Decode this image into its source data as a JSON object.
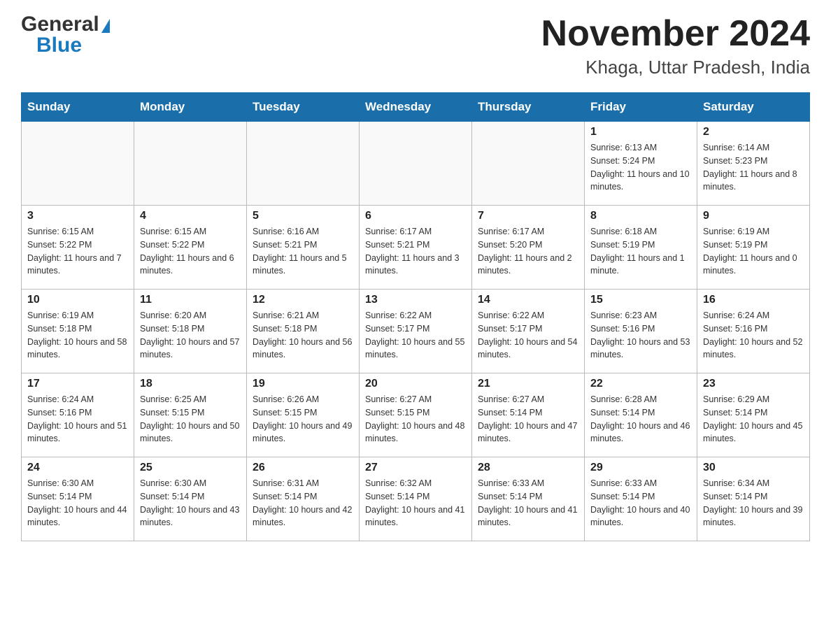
{
  "header": {
    "logo_general": "General",
    "logo_arrow": "▶",
    "logo_blue": "Blue",
    "month_title": "November 2024",
    "location": "Khaga, Uttar Pradesh, India"
  },
  "days_of_week": [
    "Sunday",
    "Monday",
    "Tuesday",
    "Wednesday",
    "Thursday",
    "Friday",
    "Saturday"
  ],
  "weeks": [
    {
      "cells": [
        {
          "day": "",
          "info": ""
        },
        {
          "day": "",
          "info": ""
        },
        {
          "day": "",
          "info": ""
        },
        {
          "day": "",
          "info": ""
        },
        {
          "day": "",
          "info": ""
        },
        {
          "day": "1",
          "info": "Sunrise: 6:13 AM\nSunset: 5:24 PM\nDaylight: 11 hours and 10 minutes."
        },
        {
          "day": "2",
          "info": "Sunrise: 6:14 AM\nSunset: 5:23 PM\nDaylight: 11 hours and 8 minutes."
        }
      ]
    },
    {
      "cells": [
        {
          "day": "3",
          "info": "Sunrise: 6:15 AM\nSunset: 5:22 PM\nDaylight: 11 hours and 7 minutes."
        },
        {
          "day": "4",
          "info": "Sunrise: 6:15 AM\nSunset: 5:22 PM\nDaylight: 11 hours and 6 minutes."
        },
        {
          "day": "5",
          "info": "Sunrise: 6:16 AM\nSunset: 5:21 PM\nDaylight: 11 hours and 5 minutes."
        },
        {
          "day": "6",
          "info": "Sunrise: 6:17 AM\nSunset: 5:21 PM\nDaylight: 11 hours and 3 minutes."
        },
        {
          "day": "7",
          "info": "Sunrise: 6:17 AM\nSunset: 5:20 PM\nDaylight: 11 hours and 2 minutes."
        },
        {
          "day": "8",
          "info": "Sunrise: 6:18 AM\nSunset: 5:19 PM\nDaylight: 11 hours and 1 minute."
        },
        {
          "day": "9",
          "info": "Sunrise: 6:19 AM\nSunset: 5:19 PM\nDaylight: 11 hours and 0 minutes."
        }
      ]
    },
    {
      "cells": [
        {
          "day": "10",
          "info": "Sunrise: 6:19 AM\nSunset: 5:18 PM\nDaylight: 10 hours and 58 minutes."
        },
        {
          "day": "11",
          "info": "Sunrise: 6:20 AM\nSunset: 5:18 PM\nDaylight: 10 hours and 57 minutes."
        },
        {
          "day": "12",
          "info": "Sunrise: 6:21 AM\nSunset: 5:18 PM\nDaylight: 10 hours and 56 minutes."
        },
        {
          "day": "13",
          "info": "Sunrise: 6:22 AM\nSunset: 5:17 PM\nDaylight: 10 hours and 55 minutes."
        },
        {
          "day": "14",
          "info": "Sunrise: 6:22 AM\nSunset: 5:17 PM\nDaylight: 10 hours and 54 minutes."
        },
        {
          "day": "15",
          "info": "Sunrise: 6:23 AM\nSunset: 5:16 PM\nDaylight: 10 hours and 53 minutes."
        },
        {
          "day": "16",
          "info": "Sunrise: 6:24 AM\nSunset: 5:16 PM\nDaylight: 10 hours and 52 minutes."
        }
      ]
    },
    {
      "cells": [
        {
          "day": "17",
          "info": "Sunrise: 6:24 AM\nSunset: 5:16 PM\nDaylight: 10 hours and 51 minutes."
        },
        {
          "day": "18",
          "info": "Sunrise: 6:25 AM\nSunset: 5:15 PM\nDaylight: 10 hours and 50 minutes."
        },
        {
          "day": "19",
          "info": "Sunrise: 6:26 AM\nSunset: 5:15 PM\nDaylight: 10 hours and 49 minutes."
        },
        {
          "day": "20",
          "info": "Sunrise: 6:27 AM\nSunset: 5:15 PM\nDaylight: 10 hours and 48 minutes."
        },
        {
          "day": "21",
          "info": "Sunrise: 6:27 AM\nSunset: 5:14 PM\nDaylight: 10 hours and 47 minutes."
        },
        {
          "day": "22",
          "info": "Sunrise: 6:28 AM\nSunset: 5:14 PM\nDaylight: 10 hours and 46 minutes."
        },
        {
          "day": "23",
          "info": "Sunrise: 6:29 AM\nSunset: 5:14 PM\nDaylight: 10 hours and 45 minutes."
        }
      ]
    },
    {
      "cells": [
        {
          "day": "24",
          "info": "Sunrise: 6:30 AM\nSunset: 5:14 PM\nDaylight: 10 hours and 44 minutes."
        },
        {
          "day": "25",
          "info": "Sunrise: 6:30 AM\nSunset: 5:14 PM\nDaylight: 10 hours and 43 minutes."
        },
        {
          "day": "26",
          "info": "Sunrise: 6:31 AM\nSunset: 5:14 PM\nDaylight: 10 hours and 42 minutes."
        },
        {
          "day": "27",
          "info": "Sunrise: 6:32 AM\nSunset: 5:14 PM\nDaylight: 10 hours and 41 minutes."
        },
        {
          "day": "28",
          "info": "Sunrise: 6:33 AM\nSunset: 5:14 PM\nDaylight: 10 hours and 41 minutes."
        },
        {
          "day": "29",
          "info": "Sunrise: 6:33 AM\nSunset: 5:14 PM\nDaylight: 10 hours and 40 minutes."
        },
        {
          "day": "30",
          "info": "Sunrise: 6:34 AM\nSunset: 5:14 PM\nDaylight: 10 hours and 39 minutes."
        }
      ]
    }
  ]
}
